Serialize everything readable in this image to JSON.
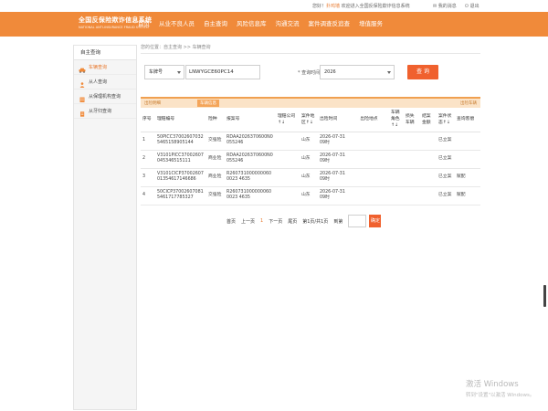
{
  "topbar": {
    "welcome_prefix": "您好！",
    "user": "扑鸡墙",
    "welcome_suffix": "  欢迎进入全国反保险欺诈信息系统",
    "my_messages": "我的消息",
    "logout": "退出"
  },
  "header": {
    "logo_cn": "全国反保险欺诈信息系统",
    "logo_en": "NATIONAL ANTI-INSURANCE FRAUD SYSTEM",
    "nav": [
      "首页",
      "从业不良人员",
      "自主查询",
      "风险信息库",
      "沟通交流",
      "案件调查反追查",
      "增值服务"
    ]
  },
  "sidebar": {
    "title": "自主查询",
    "items": [
      {
        "label": "车辆查询",
        "active": true
      },
      {
        "label": "从人查询",
        "active": false
      },
      {
        "label": "从保理机构查询",
        "active": false
      },
      {
        "label": "从牙归查询",
        "active": false
      }
    ]
  },
  "breadcrumb": "您的位置：自主查询 >> 车辆查询",
  "search": {
    "field_select": "车牌号",
    "field_value": "LNWYGCE60PC14",
    "time_label": "* 查询时间：",
    "time_value": "2026",
    "query_button": "查 询"
  },
  "table": {
    "bar_left": "出险明细",
    "bar_tag": "车辆信息",
    "bar_right": "出险车辆",
    "headers": [
      "序号",
      "理赔编号",
      "险种",
      "报案号",
      "理赔公司↑↓",
      "案件地区↑↓",
      "出险时间",
      "出险地点",
      "车辆角色↑↓",
      "损失车辆",
      "结案金额",
      "案件状态↑↓",
      "查询客偿"
    ],
    "rows": [
      {
        "no": "1",
        "claim_no": "50PICC370026070325465158905144",
        "kind": "交强险",
        "report_no": "RDAA2026370600N0055246",
        "company": "",
        "region": "山东",
        "time": "2026-07-31 09时",
        "place": "",
        "role": "",
        "loss": "",
        "amount": "",
        "status": "已立案",
        "extra": ""
      },
      {
        "no": "2",
        "claim_no": "V3101PICC37002607045346515111",
        "kind": "商业险",
        "report_no": "RDAA2026370600N0055246",
        "company": "",
        "region": "山东",
        "time": "2026-07-31 09时",
        "place": "",
        "role": "",
        "loss": "",
        "amount": "",
        "status": "已立案",
        "extra": ""
      },
      {
        "no": "3",
        "claim_no": "V3101CICP3700260701354617146686",
        "kind": "商业险",
        "report_no": "R2607310000000600023 4635",
        "company": "",
        "region": "山东",
        "time": "2026-07-31 09时",
        "place": "",
        "role": "",
        "loss": "",
        "amount": "",
        "status": "已立案",
        "extra": "赋配"
      },
      {
        "no": "4",
        "claim_no": "50CICP370026070815461717785327",
        "kind": "交强险",
        "report_no": "R2607310000000600023 4635",
        "company": "",
        "region": "山东",
        "time": "2026-07-31 09时",
        "place": "",
        "role": "",
        "loss": "",
        "amount": "",
        "status": "已立案",
        "extra": "赋配"
      }
    ]
  },
  "pager": {
    "first": "首页",
    "prev": "上一页",
    "current": "1",
    "next": "下一页",
    "last": "尾页",
    "info": "第1页/共1页",
    "goto_label": "到第",
    "go": "确定"
  },
  "watermark": {
    "line1": "激活 Windows",
    "line2": "转到\"设置\"以激活 Windows。"
  },
  "colors": {
    "brand": "#f08a3a",
    "button": "#f0612e",
    "accent_text": "#e8782c"
  }
}
